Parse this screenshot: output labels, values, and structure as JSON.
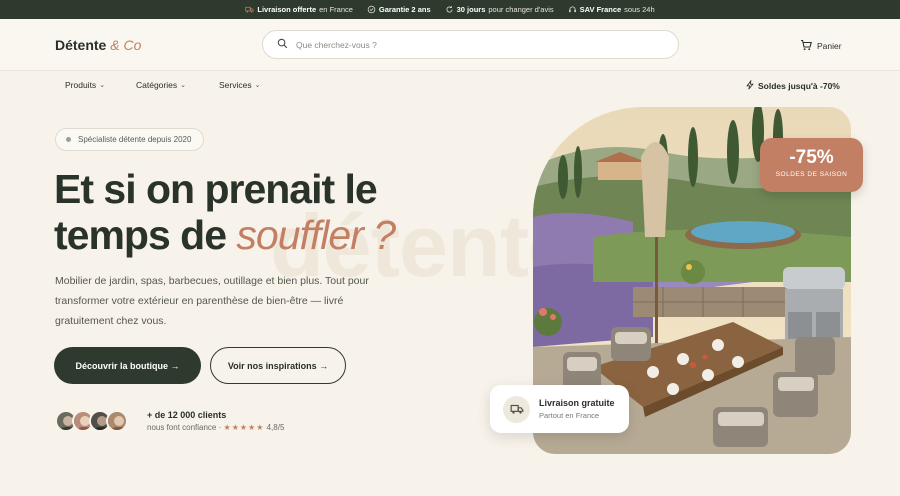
{
  "topbar": {
    "items": [
      {
        "bold": "Livraison offerte",
        "rest": "en France",
        "icon": "truck-icon"
      },
      {
        "bold": "Garantie 2 ans",
        "rest": "",
        "icon": "check-circle-icon"
      },
      {
        "bold": "30 jours",
        "rest": "pour changer d'avis",
        "icon": "refresh-icon"
      },
      {
        "bold": "SAV France",
        "rest": "sous 24h",
        "icon": "headset-icon"
      }
    ]
  },
  "header": {
    "logo_main": "Détente",
    "logo_accent": "& Co",
    "search_placeholder": "Que cherchez-vous ?",
    "cart_label": "Panier"
  },
  "nav": {
    "items": [
      {
        "label": "Produits",
        "chevron": "⌄"
      },
      {
        "label": "Catégories",
        "chevron": "⌄"
      },
      {
        "label": "Services",
        "chevron": "⌄"
      }
    ],
    "promo": "Soldes jusqu'à -70%"
  },
  "hero": {
    "badge": "Spécialiste détente depuis 2020",
    "headline_line1": "Et si on prenait le",
    "headline_line2": "temps de",
    "headline_accent": "souffler ?",
    "bg_watermark": "détente",
    "subtitle": "Mobilier de jardin, spas, barbecues, outillage et bien plus. Tout pour transformer votre extérieur en parenthèse de bien-être — livré gratuitement chez vous.",
    "cta_primary": "Découvrir la boutique →",
    "cta_secondary": "Voir nos inspirations →",
    "customers_count": "+ de 12 000 clients",
    "customers_trust": "nous font confiance ·",
    "stars": "★★★★★",
    "rating": "4,8/5"
  },
  "discount_card": {
    "percent": "-75%",
    "label": "SOLDES DE SAISON"
  },
  "delivery_card": {
    "title": "Livraison gratuite",
    "subtitle": "Partout en France"
  },
  "colors": {
    "dark_green": "#2e3a2e",
    "terracotta": "#c27f63",
    "cream": "#f7f2ea"
  }
}
